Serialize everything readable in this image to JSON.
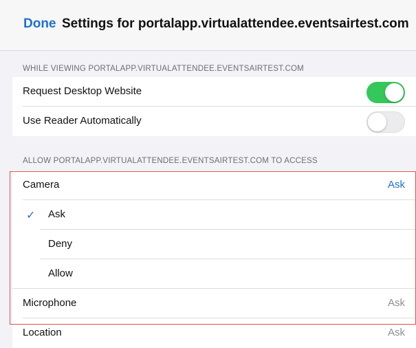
{
  "nav": {
    "done_label": "Done",
    "title": "Settings for portalapp.virtualattendee.eventsairtest.com"
  },
  "section_viewing": {
    "header": "WHILE VIEWING PORTALAPP.VIRTUALATTENDEE.EVENTSAIRTEST.COM",
    "rows": [
      {
        "label": "Request Desktop Website",
        "toggle": "on"
      },
      {
        "label": "Use Reader Automatically",
        "toggle": "off"
      }
    ]
  },
  "section_access": {
    "header": "ALLOW PORTALAPP.VIRTUALATTENDEE.EVENTSAIRTEST.COM TO ACCESS",
    "camera": {
      "label": "Camera",
      "value": "Ask"
    },
    "camera_options": [
      {
        "label": "Ask",
        "selected": true
      },
      {
        "label": "Deny",
        "selected": false
      },
      {
        "label": "Allow",
        "selected": false
      }
    ],
    "microphone": {
      "label": "Microphone",
      "value": "Ask"
    },
    "location": {
      "label": "Location",
      "value": "Ask"
    }
  },
  "colors": {
    "accent": "#1f6fd1",
    "toggle_on": "#34c759",
    "highlight_border": "#d9534f"
  },
  "icons": {
    "selected_mark": "checkmark-icon"
  }
}
